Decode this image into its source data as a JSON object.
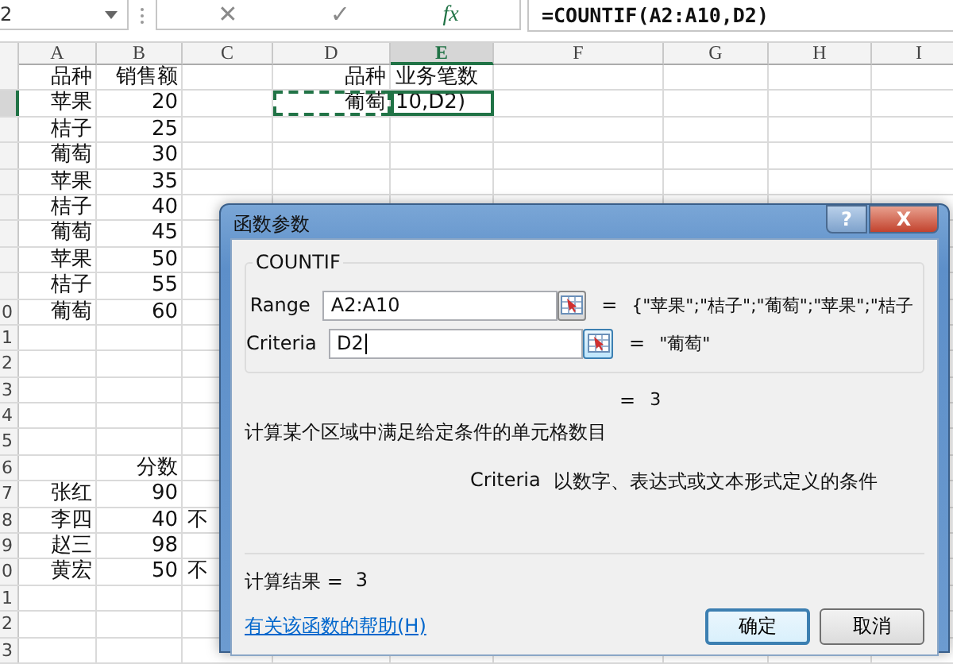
{
  "formula_bar": {
    "name_box": "2",
    "cancel": "✕",
    "enter": "✓",
    "function": "fx",
    "formula": "=COUNTIF(A2:A10,D2)"
  },
  "columns": [
    {
      "label": "A",
      "selected": false
    },
    {
      "label": "B",
      "selected": false
    },
    {
      "label": "C",
      "selected": false
    },
    {
      "label": "D",
      "selected": false
    },
    {
      "label": "E",
      "selected": true
    },
    {
      "label": "F",
      "selected": false
    },
    {
      "label": "G",
      "selected": false
    },
    {
      "label": "H",
      "selected": false
    },
    {
      "label": "I",
      "selected": false
    }
  ],
  "rows": [
    {
      "selected": false,
      "cells": {
        "a": "品种",
        "b": "销售额",
        "d": "品种",
        "e": "业务笔数"
      }
    },
    {
      "selected": true,
      "cells": {
        "a": "苹果",
        "b": "20",
        "d": {
          "text": "葡萄",
          "referenced": true
        },
        "e": "10,D2)"
      }
    },
    {
      "selected": false,
      "cells": {
        "a": "桔子",
        "b": "25"
      }
    },
    {
      "selected": false,
      "cells": {
        "a": "葡萄",
        "b": "30"
      }
    },
    {
      "selected": false,
      "cells": {
        "a": "苹果",
        "b": "35"
      }
    },
    {
      "selected": false,
      "cells": {
        "a": "桔子",
        "b": "40"
      }
    },
    {
      "selected": false,
      "cells": {
        "a": "葡萄",
        "b": "45"
      }
    },
    {
      "selected": false,
      "cells": {
        "a": "苹果",
        "b": "50"
      }
    },
    {
      "selected": false,
      "cells": {
        "a": "桔子",
        "b": "55"
      }
    },
    {
      "selected": false,
      "number": "0",
      "cells": {
        "a": "葡萄",
        "b": "60"
      }
    },
    {
      "selected": false,
      "number": "1",
      "cells": {}
    },
    {
      "selected": false,
      "number": "2",
      "cells": {}
    },
    {
      "selected": false,
      "number": "3",
      "cells": {}
    },
    {
      "selected": false,
      "number": "4",
      "cells": {}
    },
    {
      "selected": false,
      "number": "5",
      "cells": {}
    },
    {
      "selected": false,
      "number": "6",
      "cells": {
        "b": "分数"
      }
    },
    {
      "selected": false,
      "number": "7",
      "cells": {
        "a": "张红",
        "b": "90"
      }
    },
    {
      "selected": false,
      "number": "8",
      "cells": {
        "a": "李四",
        "b": "40",
        "c": "不"
      }
    },
    {
      "selected": false,
      "number": "9",
      "cells": {
        "a": "赵三",
        "b": "98"
      }
    },
    {
      "selected": false,
      "number": "0",
      "cells": {
        "a": "黄宏",
        "b": "50",
        "c": "不"
      }
    },
    {
      "selected": false,
      "number": "1",
      "cells": {}
    },
    {
      "selected": false,
      "number": "2",
      "cells": {}
    },
    {
      "selected": false,
      "number": "3",
      "cells": {}
    }
  ],
  "dialog": {
    "title": "函数参数",
    "help_button": "?",
    "close_button": "X",
    "function_name": "COUNTIF",
    "arguments": [
      {
        "label": "Range",
        "value": "A2:A10",
        "focused": false,
        "equals": "=",
        "result": "{\"苹果\";\"桔子\";\"葡萄\";\"苹果\";\"桔子"
      },
      {
        "label": "Criteria",
        "value": "D2",
        "focused": true,
        "equals": "=",
        "result": "\"葡萄\""
      }
    ],
    "result_equals": "=",
    "result": "3",
    "description": "计算某个区域中满足给定条件的单元格数目",
    "argument_help": {
      "name": "Criteria",
      "text": "以数字、表达式或文本形式定义的条件"
    },
    "calc_label": "计算结果 =",
    "calc_value": "3",
    "help_link": "有关该函数的帮助(H)",
    "ok": "确定",
    "cancel": "取消"
  }
}
